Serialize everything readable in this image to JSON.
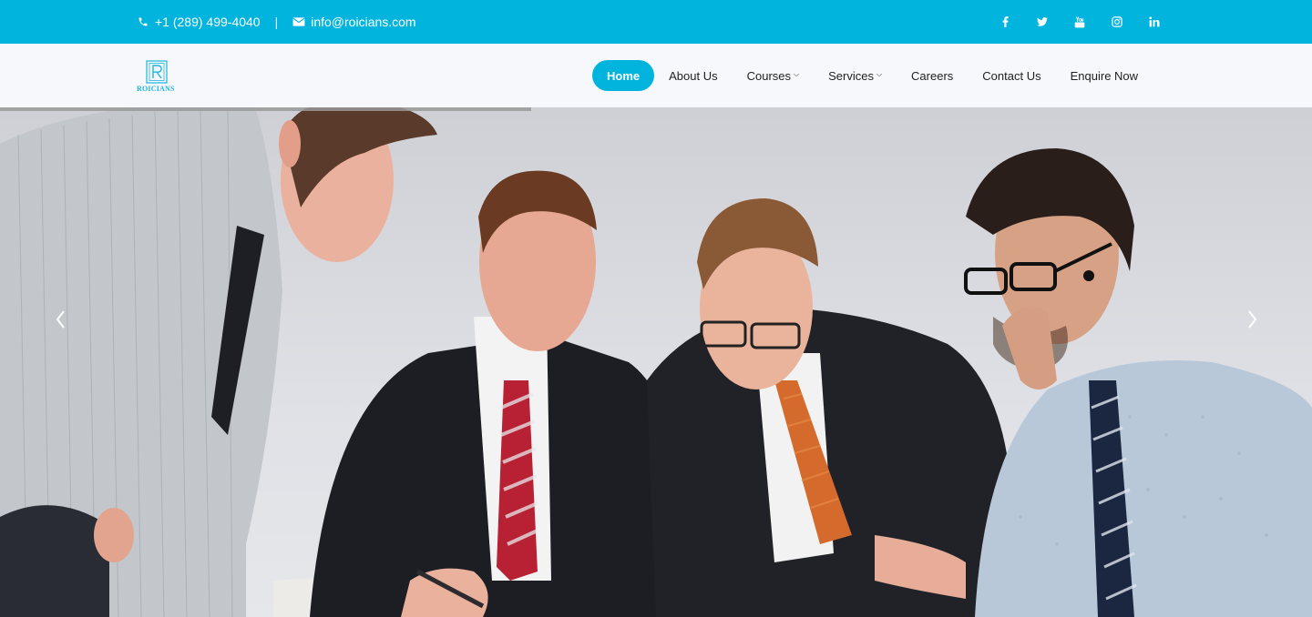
{
  "topbar": {
    "phone": "+1 (289) 499-4040",
    "separator": "|",
    "email": "info@roicians.com",
    "social": [
      "facebook-icon",
      "twitter-icon",
      "youtube-icon",
      "instagram-icon",
      "linkedin-icon"
    ]
  },
  "brand": {
    "name": "ROICIANS"
  },
  "nav": {
    "items": [
      {
        "label": "Home",
        "active": true
      },
      {
        "label": "About Us"
      },
      {
        "label": "Courses",
        "dropdown": true
      },
      {
        "label": "Services",
        "dropdown": true
      },
      {
        "label": "Careers"
      },
      {
        "label": "Contact Us"
      },
      {
        "label": "Enquire Now"
      }
    ]
  },
  "hero": {
    "slider_prev_icon": "chevron-left-icon",
    "slider_next_icon": "chevron-right-icon",
    "progress": 0.405
  },
  "colors": {
    "accent": "#00b4de",
    "nav_bg": "#f6f8fb",
    "text": "#222222"
  }
}
